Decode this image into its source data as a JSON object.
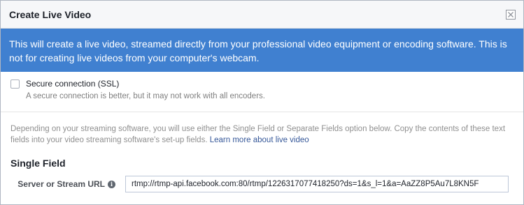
{
  "dialog": {
    "title": "Create Live Video",
    "close_icon": "close-icon"
  },
  "banner": {
    "text": "This will create a live video, streamed directly from your professional video equipment or encoding software. This is not for creating live videos from your computer's webcam."
  },
  "ssl": {
    "checkbox_label": "Secure connection (SSL)",
    "checked": false,
    "help_text": "A secure connection is better, but it may not work with all encoders."
  },
  "fields": {
    "description": "Depending on your streaming software, you will use either the Single Field or Separate Fields option below. Copy the contents of these text fields into your video streaming software's set-up fields.",
    "learn_more_link": "Learn more about live video",
    "single_field_heading": "Single Field",
    "server_url_label": "Server or Stream URL",
    "info_icon": "info-icon",
    "server_url_value": "rtmp://rtmp-api.facebook.com:80/rtmp/1226317077418250?ds=1&s_l=1&a=AaZZ8P5Au7L8KN5F"
  },
  "colors": {
    "banner_bg": "#4080d0",
    "link": "#365899",
    "title_bar_bg": "#f6f7f9"
  }
}
